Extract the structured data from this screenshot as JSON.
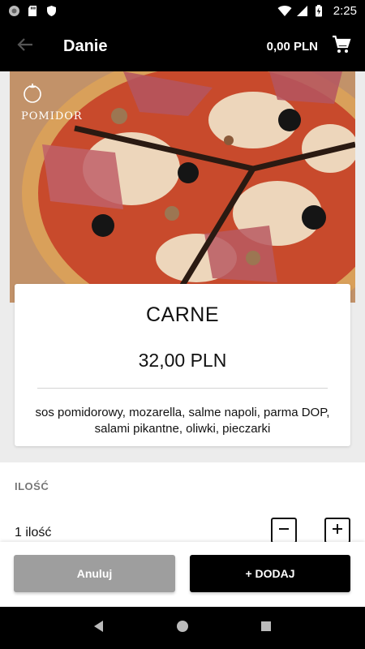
{
  "status_bar": {
    "time": "2:25",
    "icons": [
      "circle-notification-icon",
      "sd-card-icon",
      "shield-icon",
      "wifi-icon",
      "signal-icon",
      "battery-charging-icon"
    ]
  },
  "app_bar": {
    "title": "Danie",
    "cart_total": "0,00 PLN",
    "icons": [
      "arrow-back-icon",
      "shopping-cart-icon"
    ]
  },
  "hero": {
    "brand": "POMIDOR"
  },
  "dish": {
    "name": "CARNE",
    "price": "32,00 PLN",
    "description": "sos pomidorowy, mozarella, salme napoli, parma DOP, salami pikantne, oliwki, pieczarki"
  },
  "quantity": {
    "header": "ILOŚĆ",
    "label": "1 ilość",
    "value": 1
  },
  "actions": {
    "cancel_label": "Anuluj",
    "add_label": "+ DODAJ"
  },
  "colors": {
    "app_bar_bg": "#000000",
    "cancel_bg": "#9e9e9e",
    "add_bg": "#000000",
    "page_bg": "#ececec"
  },
  "nav_bar": {
    "icons": [
      "back-triangle-icon",
      "home-circle-icon",
      "recents-square-icon"
    ]
  }
}
